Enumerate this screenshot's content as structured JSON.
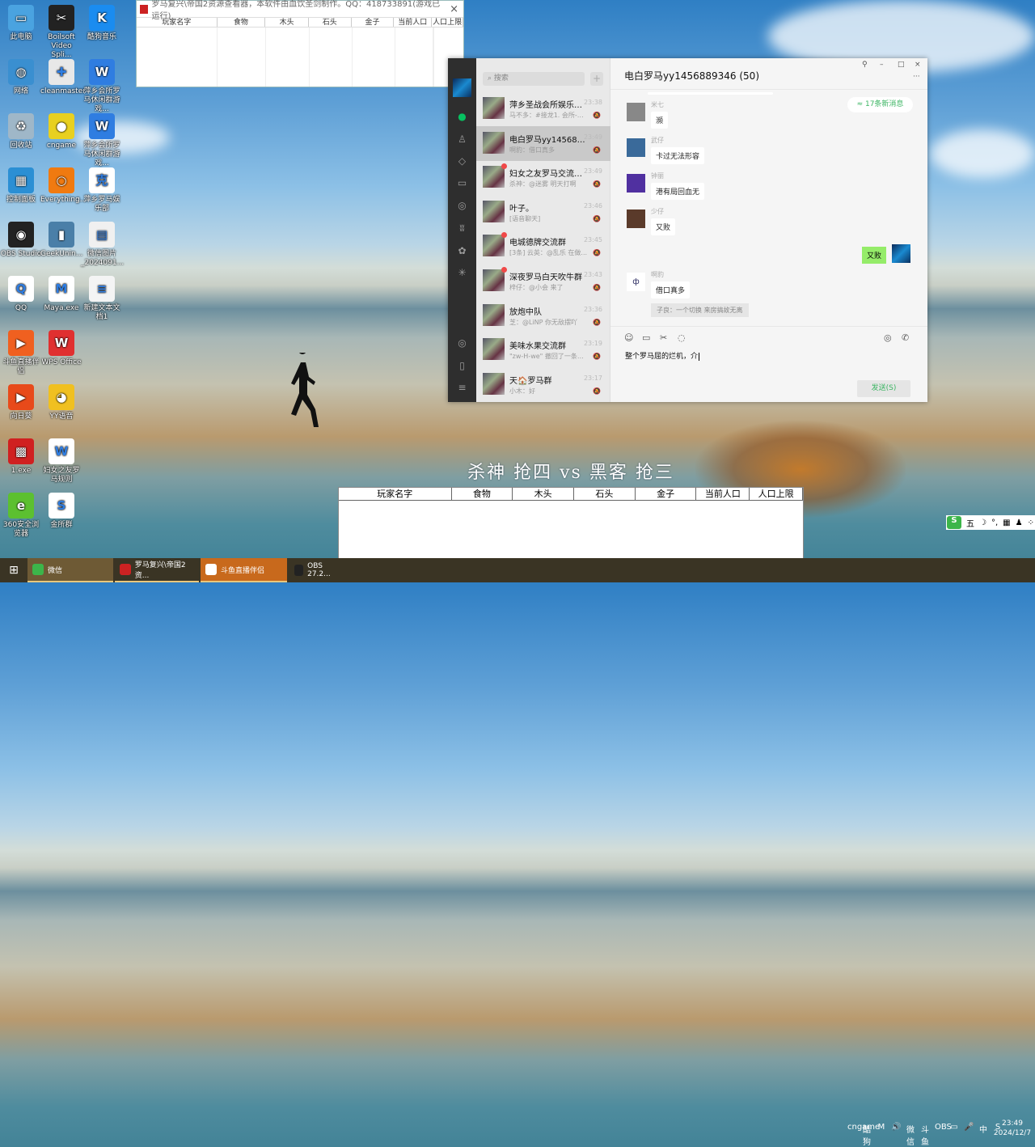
{
  "desktop_icons": [
    {
      "label": "此电脑",
      "color": "#4aa3e0",
      "glyph": "▭"
    },
    {
      "label": "Boilsoft Video Spli...",
      "color": "#222",
      "glyph": "✂"
    },
    {
      "label": "酷狗音乐",
      "color": "#1a8cf0",
      "glyph": "K"
    },
    {
      "label": "网络",
      "color": "#3a8fd0",
      "glyph": "◍"
    },
    {
      "label": "cleanmaster",
      "color": "#e8e8e8",
      "glyph": "✚"
    },
    {
      "label": "萍乡会所罗马休闲群游戏...",
      "color": "#2f7de1",
      "glyph": "W"
    },
    {
      "label": "回收站",
      "color": "#9fb7c8",
      "glyph": "♻"
    },
    {
      "label": "cngame",
      "color": "#e8d020",
      "glyph": "●"
    },
    {
      "label": "萍乡会所罗马休闲群游戏...",
      "color": "#2f7de1",
      "glyph": "W"
    },
    {
      "label": "控制面板",
      "color": "#2b8fd4",
      "glyph": "▦"
    },
    {
      "label": "Everything...",
      "color": "#f07a10",
      "glyph": "○"
    },
    {
      "label": "萍乡罗马娱乐部",
      "color": "#fff",
      "glyph": "克"
    },
    {
      "label": "OBS Studio",
      "color": "#222",
      "glyph": "◉"
    },
    {
      "label": "GeekUnin...",
      "color": "#4a7fa8",
      "glyph": "▮"
    },
    {
      "label": "微信图片_2024091...",
      "color": "#f0f0f0",
      "glyph": "▤"
    },
    {
      "label": "QQ",
      "color": "#fff",
      "glyph": "Q"
    },
    {
      "label": "Maya.exe",
      "color": "#fff",
      "glyph": "M"
    },
    {
      "label": "新建文本文档1",
      "color": "#f4f4f4",
      "glyph": "≡"
    },
    {
      "label": "斗鱼直播伴侣",
      "color": "#f06020",
      "glyph": "▶"
    },
    {
      "label": "WPS Office",
      "color": "#e03030",
      "glyph": "W"
    },
    {
      "label": "向日葵",
      "color": "#e84a1a",
      "glyph": "▶"
    },
    {
      "label": "YY语音",
      "color": "#f0c020",
      "glyph": "◕"
    },
    {
      "label": "1.exe",
      "color": "#d02020",
      "glyph": "▩"
    },
    {
      "label": "妇女之友罗马规则",
      "color": "#fff",
      "glyph": "W"
    },
    {
      "label": "360安全浏览器",
      "color": "#5cc030",
      "glyph": "e"
    },
    {
      "label": "金所群",
      "color": "#fff",
      "glyph": "S"
    }
  ],
  "resource_window": {
    "title": "罗马复兴\\帝国2资源查看器，本软件由血饮圣剑制作。QQ：418733891(游戏已运行)",
    "close": "×",
    "columns": [
      "玩家名字",
      "食物",
      "木头",
      "石头",
      "金子",
      "当前人口",
      "人口上限"
    ]
  },
  "wechat": {
    "search_placeholder": "搜索",
    "add": "+",
    "chat_title": "电白罗马yy1456889346 (50)",
    "window_buttons": {
      "pin": "⚲",
      "min": "–",
      "max": "□",
      "close": "×",
      "more": "···"
    },
    "chats": [
      {
        "name": "萍乡圣战会所娱乐群...",
        "time": "23:38",
        "preview": "马不多：#接龙1. 会所-马...",
        "unread": false,
        "selected": false
      },
      {
        "name": "电白罗马yy1456889...",
        "time": "23:49",
        "preview": "啊豹：借口真多",
        "unread": false,
        "selected": true
      },
      {
        "name": "妇女之友罗马交流群...",
        "time": "23:49",
        "preview": "杀神：@迷雾 明天打啊",
        "unread": true,
        "selected": false
      },
      {
        "name": "叶子。",
        "time": "23:46",
        "preview": "[语音聊天]",
        "unread": false,
        "selected": false
      },
      {
        "name": "电城德牌交流群",
        "time": "23:45",
        "preview": "[3条] 云英：@乱乐 在做...",
        "unread": true,
        "selected": false
      },
      {
        "name": "深夜罗马白天吹牛群",
        "time": "23:43",
        "preview": "梓仔：@小会 来了",
        "unread": true,
        "selected": false
      },
      {
        "name": "放炮中队",
        "time": "23:36",
        "preview": "芝：@LiNP 你无敌摆吖",
        "unread": false,
        "selected": false
      },
      {
        "name": "美味水果交流群",
        "time": "23:19",
        "preview": "\"zw-H-we\" 撤回了一条消...",
        "unread": false,
        "selected": false
      },
      {
        "name": "天🏠罗马群",
        "time": "23:17",
        "preview": "小木：好",
        "unread": false,
        "selected": false
      }
    ],
    "new_messages": "≈ 17条新消息",
    "messages": [
      {
        "sender": "米七",
        "text": "濒",
        "avatar": "#888"
      },
      {
        "sender": "武仔",
        "text": "卡过无法形容",
        "avatar": "#3a6a9a"
      },
      {
        "sender": "钟丽",
        "text": "港有局回血无",
        "avatar": "#5030a0"
      },
      {
        "sender": "少仔",
        "text": "又败",
        "avatar": "#5a3a2a"
      }
    ],
    "my_message": "又败",
    "last_message": {
      "sender": "啊豹",
      "text": "借口真多",
      "quote": "子良：一个切换 来房搞故无离"
    },
    "input_text": "整个罗马屈的烂机，介",
    "send_label": "发送(S)"
  },
  "overlay_title": "杀神 抢四 vs 黑客 抢三",
  "game_table": {
    "columns": [
      "玩家名字",
      "食物",
      "木头",
      "石头",
      "金子",
      "当前人口",
      "人口上限"
    ]
  },
  "ime": {
    "mode": "五",
    "icon": "S"
  },
  "taskbar": {
    "items": [
      {
        "label": "微信",
        "color": "#3cb54a",
        "active": true,
        "bg": "#6e5a35"
      },
      {
        "label": "罗马复兴\\帝国2资...",
        "color": "#c22",
        "active": true,
        "bg": "#3a3424"
      },
      {
        "label": "斗鱼直播伴侣",
        "color": "#fff",
        "active": true,
        "bg": "#c8691c"
      },
      {
        "label": "OBS 27.2...",
        "color": "#222",
        "active": false,
        "bg": "#3a3424"
      }
    ],
    "tray": [
      "cngame",
      "酷狗",
      "M",
      "🔊",
      "微信",
      "斗鱼",
      "OBS",
      "▭",
      "🎤",
      "中",
      "S"
    ],
    "time": "23:49",
    "date": "2024/12/7"
  }
}
